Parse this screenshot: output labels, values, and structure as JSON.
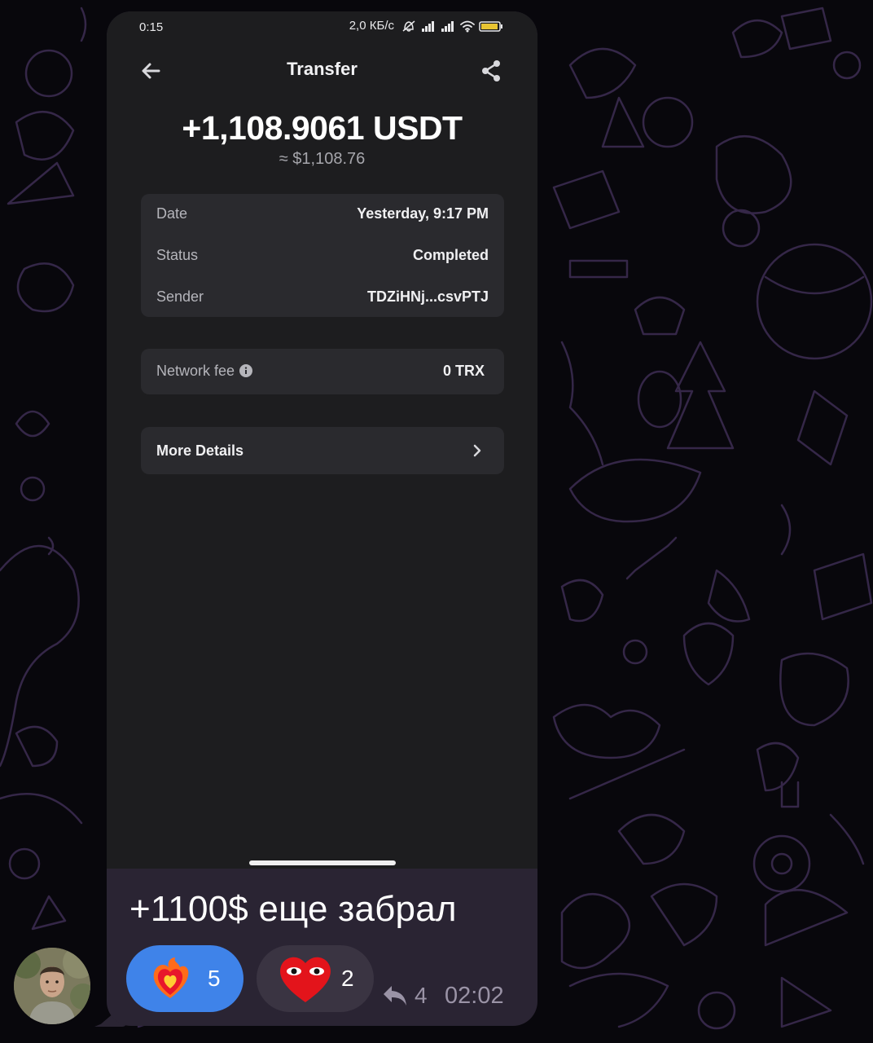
{
  "statusbar": {
    "time": "0:15",
    "net_speed": "2,0 КБ/с",
    "icons": [
      "mute-bell-icon",
      "signal-icon",
      "signal-icon",
      "wifi-icon",
      "battery-icon"
    ]
  },
  "appbar": {
    "title": "Transfer",
    "back_icon": "arrow-left-icon",
    "share_icon": "share-icon"
  },
  "transfer": {
    "amount": "+1,108.9061 USDT",
    "fiat": "≈ $1,108.76"
  },
  "details": {
    "rows": [
      {
        "label": "Date",
        "value": "Yesterday, 9:17 PM"
      },
      {
        "label": "Status",
        "value": "Completed"
      },
      {
        "label": "Sender",
        "value": "TDZiHNj...csvPTJ"
      }
    ]
  },
  "fee": {
    "label": "Network fee",
    "value": "0 TRX",
    "icon": "info-icon"
  },
  "more": {
    "label": "More Details",
    "icon": "chevron-right-icon"
  },
  "message": {
    "text": "+1100$ еще забрал",
    "reactions": [
      {
        "icon": "fire-heart-icon",
        "count": "5",
        "selected": true
      },
      {
        "icon": "red-heart-eyes-icon",
        "count": "2",
        "selected": false
      }
    ],
    "replies": {
      "icon": "reply-arrow-icon",
      "count": "4"
    },
    "time": "02:02"
  },
  "colors": {
    "chat_bg": "#08070c",
    "bubble": "#2a2433",
    "phone_bg": "#1d1d1f",
    "card": "#2a2a2e",
    "reaction_selected": "#3f83e9",
    "reaction_default": "#3a3442",
    "doodle_stroke": "#3a2b4f"
  }
}
